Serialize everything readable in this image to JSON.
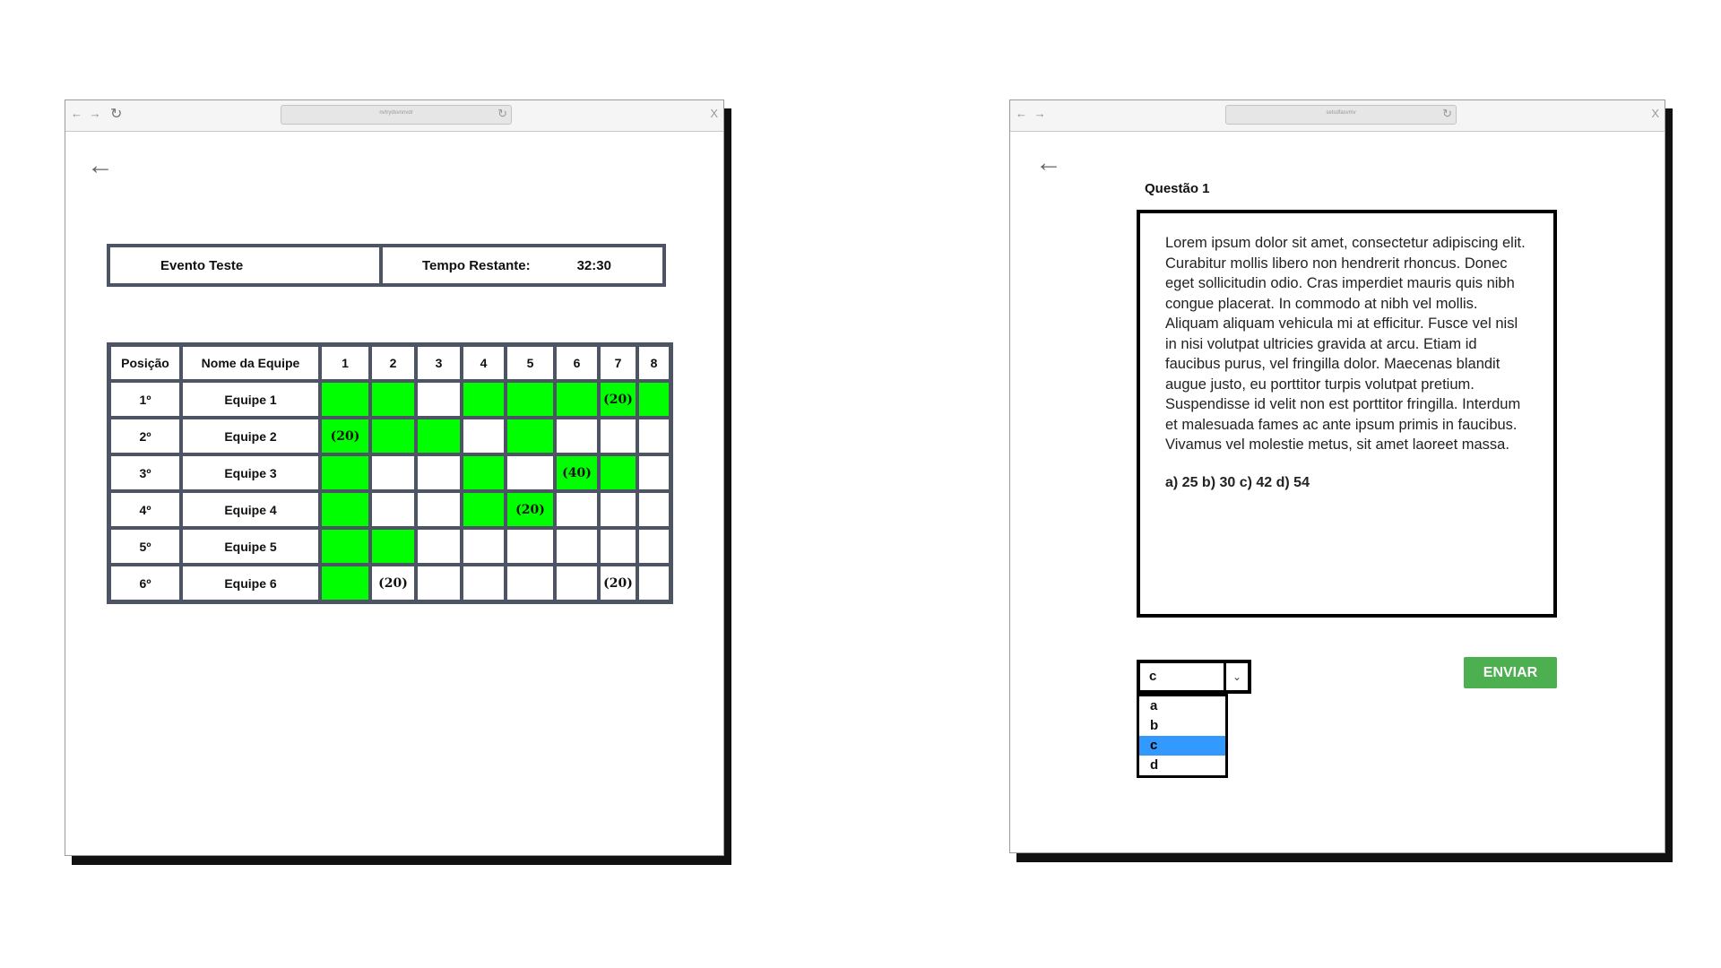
{
  "left_window": {
    "address_text": "nvtrydsvnnvdr",
    "event_name": "Evento Teste",
    "timer_label": "Tempo Restante:",
    "timer_value": "32:30",
    "headers": [
      "Posição",
      "Nome da Equipe",
      "1",
      "2",
      "3",
      "4",
      "5",
      "6",
      "7",
      "8"
    ],
    "rows": [
      {
        "pos": "1º",
        "team": "Equipe 1",
        "cells": [
          {
            "s": "ok",
            "t": ""
          },
          {
            "s": "ok",
            "t": ""
          },
          {
            "s": "",
            "t": ""
          },
          {
            "s": "ok",
            "t": ""
          },
          {
            "s": "ok",
            "t": ""
          },
          {
            "s": "ok",
            "t": ""
          },
          {
            "s": "ok",
            "t": "(20)"
          },
          {
            "s": "ok",
            "t": ""
          }
        ]
      },
      {
        "pos": "2º",
        "team": "Equipe 2",
        "cells": [
          {
            "s": "ok",
            "t": "(20)"
          },
          {
            "s": "ok",
            "t": ""
          },
          {
            "s": "ok",
            "t": ""
          },
          {
            "s": "",
            "t": ""
          },
          {
            "s": "ok",
            "t": ""
          },
          {
            "s": "",
            "t": ""
          },
          {
            "s": "",
            "t": ""
          },
          {
            "s": "",
            "t": ""
          }
        ]
      },
      {
        "pos": "3º",
        "team": "Equipe 3",
        "cells": [
          {
            "s": "ok",
            "t": ""
          },
          {
            "s": "",
            "t": ""
          },
          {
            "s": "",
            "t": ""
          },
          {
            "s": "ok",
            "t": ""
          },
          {
            "s": "",
            "t": ""
          },
          {
            "s": "ok",
            "t": "(40)"
          },
          {
            "s": "ok",
            "t": ""
          },
          {
            "s": "",
            "t": ""
          }
        ]
      },
      {
        "pos": "4º",
        "team": "Equipe 4",
        "cells": [
          {
            "s": "ok",
            "t": ""
          },
          {
            "s": "",
            "t": ""
          },
          {
            "s": "",
            "t": ""
          },
          {
            "s": "ok",
            "t": ""
          },
          {
            "s": "ok",
            "t": "(20)"
          },
          {
            "s": "",
            "t": ""
          },
          {
            "s": "",
            "t": ""
          },
          {
            "s": "",
            "t": ""
          }
        ]
      },
      {
        "pos": "5º",
        "team": "Equipe 5",
        "cells": [
          {
            "s": "ok",
            "t": ""
          },
          {
            "s": "ok",
            "t": ""
          },
          {
            "s": "",
            "t": ""
          },
          {
            "s": "",
            "t": ""
          },
          {
            "s": "",
            "t": ""
          },
          {
            "s": "",
            "t": ""
          },
          {
            "s": "",
            "t": ""
          },
          {
            "s": "",
            "t": ""
          }
        ]
      },
      {
        "pos": "6º",
        "team": "Equipe 6",
        "cells": [
          {
            "s": "ok",
            "t": ""
          },
          {
            "s": "",
            "t": "(20)"
          },
          {
            "s": "",
            "t": ""
          },
          {
            "s": "",
            "t": ""
          },
          {
            "s": "",
            "t": ""
          },
          {
            "s": "",
            "t": ""
          },
          {
            "s": "",
            "t": "(20)"
          },
          {
            "s": "",
            "t": ""
          }
        ]
      }
    ]
  },
  "right_window": {
    "address_text": "setsdfasvmv",
    "question_title": "Questão 1",
    "question_text": "Lorem ipsum dolor sit amet, consectetur adipiscing elit. Curabitur mollis libero non hendrerit rhoncus. Donec eget sollicitudin odio. Cras imperdiet mauris quis nibh congue placerat. In commodo at nibh vel mollis. Aliquam aliquam vehicula mi at efficitur. Fusce vel nisl in nisi volutpat ultricies gravida at arcu. Etiam id faucibus purus, vel fringilla dolor. Maecenas blandit augue justo, eu porttitor turpis volutpat pretium. Suspendisse id velit non est porttitor fringilla. Interdum et malesuada fames ac ante ipsum primis in faucibus. Vivamus vel molestie metus, sit amet laoreet massa.",
    "answer_options": "a) 25   b) 30   c) 42   d) 54",
    "select_value": "c",
    "dropdown_options": [
      "a",
      "b",
      "c",
      "d"
    ],
    "dropdown_selected": "c",
    "submit_label": "ENVIAR"
  },
  "colors": {
    "correct_cell": "#00ff00",
    "table_border": "#4d5463",
    "submit_button": "#4caf50",
    "dropdown_highlight": "#3399ff"
  },
  "icons": [
    "back-arrow-icon",
    "forward-arrow-icon",
    "reload-icon",
    "close-icon",
    "chevron-down-icon"
  ]
}
